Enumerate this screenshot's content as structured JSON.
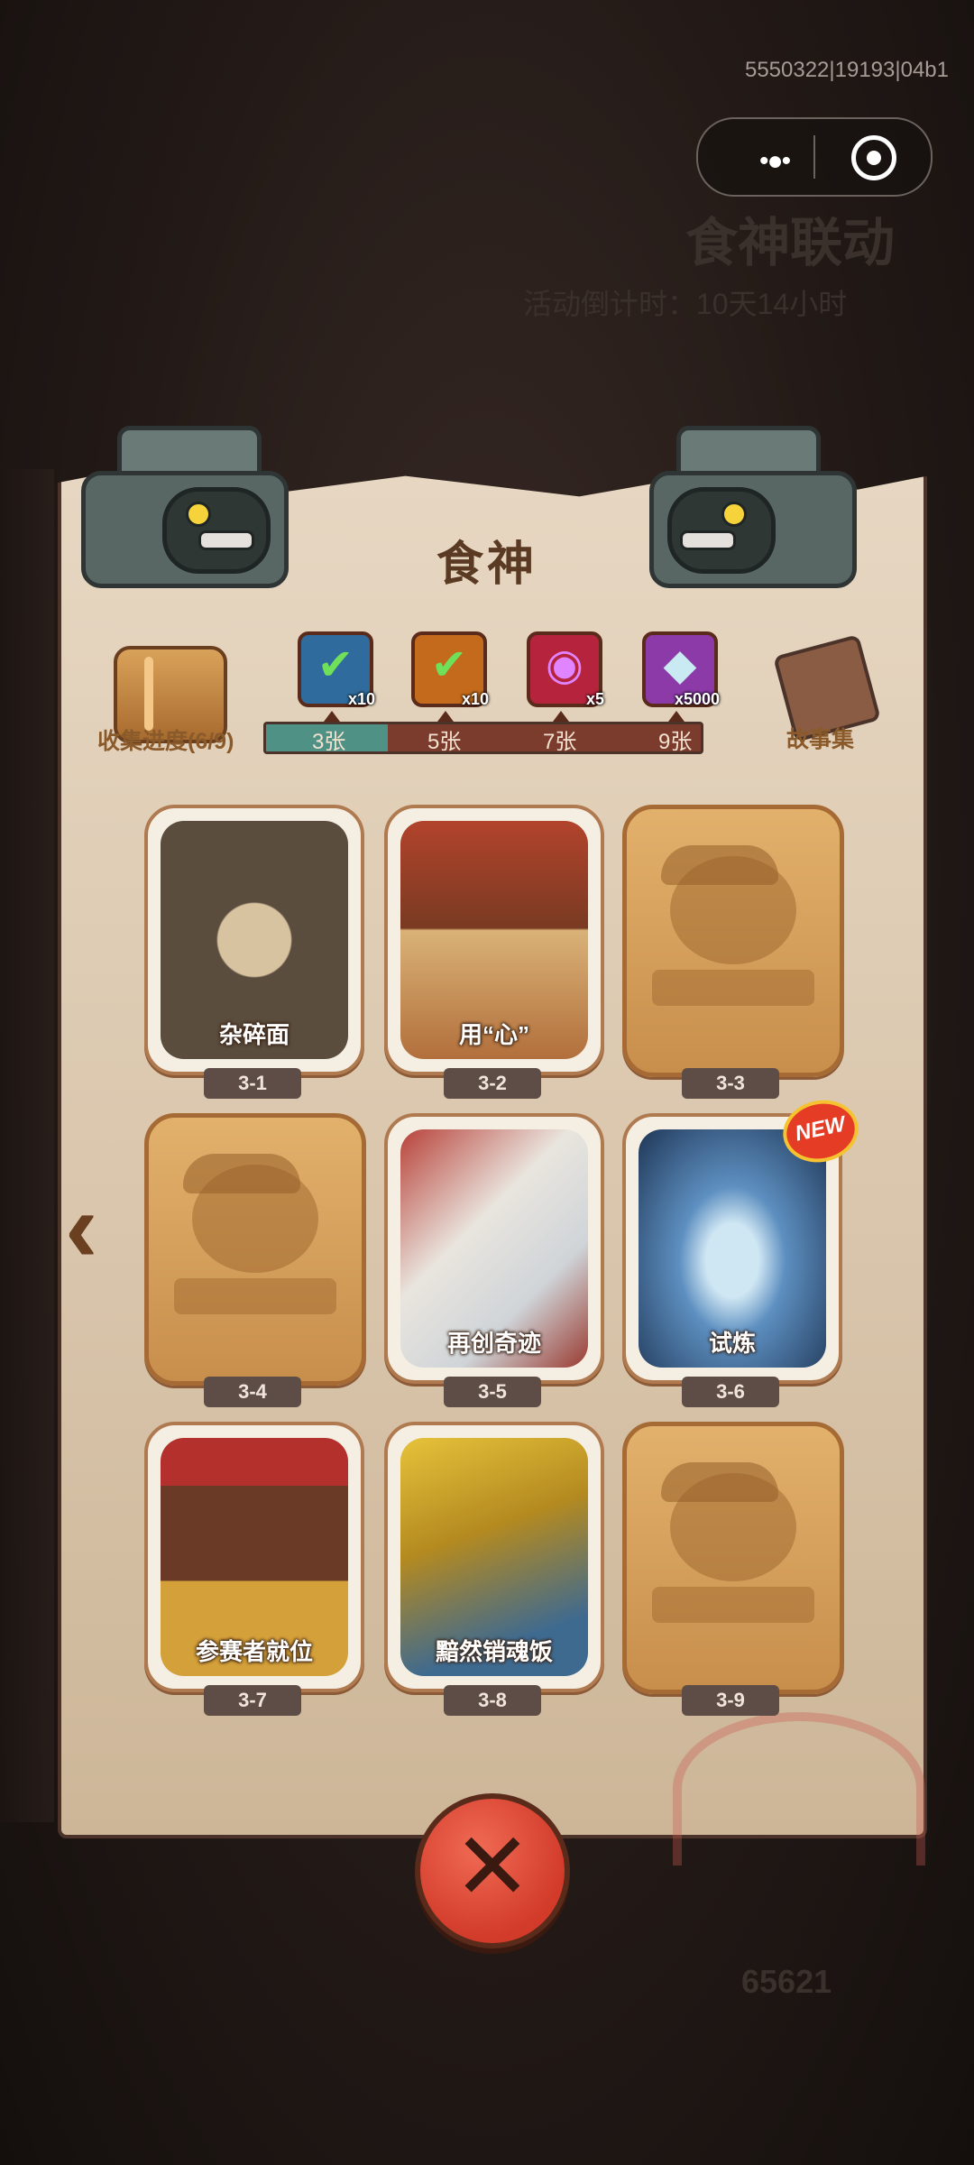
{
  "system": {
    "build_id": "5550322|19193|04b1"
  },
  "background": {
    "event_title": "食神联动",
    "timer_text": "活动倒计时：10天14小时",
    "score": "65621"
  },
  "panel": {
    "title": "食神",
    "progress_label": "收集进度(6/9)",
    "story_label": "故事集",
    "progress_fraction": 0.28
  },
  "milestones": [
    {
      "label": "3张",
      "reward": "ticket-blue-icon",
      "quantity": "x10",
      "claimed": true
    },
    {
      "label": "5张",
      "reward": "ticket-orange-icon",
      "quantity": "x10",
      "claimed": true
    },
    {
      "label": "7张",
      "reward": "disc-icon",
      "quantity": "x5",
      "claimed": false
    },
    {
      "label": "9张",
      "reward": "gem-icon",
      "quantity": "x5000",
      "claimed": false
    }
  ],
  "cards": [
    {
      "id": "3-1",
      "title": "杂碎面",
      "unlocked": true
    },
    {
      "id": "3-2",
      "title": "用“心”",
      "unlocked": true
    },
    {
      "id": "3-3",
      "title": "",
      "unlocked": false
    },
    {
      "id": "3-4",
      "title": "",
      "unlocked": false
    },
    {
      "id": "3-5",
      "title": "再创奇迹",
      "unlocked": true
    },
    {
      "id": "3-6",
      "title": "试炼",
      "unlocked": true,
      "badge": "NEW"
    },
    {
      "id": "3-7",
      "title": "参赛者就位",
      "unlocked": true
    },
    {
      "id": "3-8",
      "title": "黯然销魂饭",
      "unlocked": true
    },
    {
      "id": "3-9",
      "title": "",
      "unlocked": false
    }
  ],
  "colors": {
    "accent": "#d23b2a",
    "bar_done": "#4f9184",
    "bar_todo": "#7b3c2e",
    "paper": "#e7d7c2"
  }
}
